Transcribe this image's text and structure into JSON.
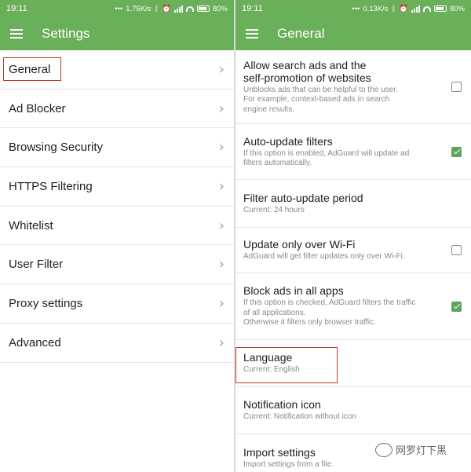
{
  "left": {
    "status": {
      "time": "19:11",
      "net_speed": "1.75K/s",
      "battery": "80%"
    },
    "toolbar_title": "Settings",
    "menu_items": [
      {
        "label": "General"
      },
      {
        "label": "Ad Blocker"
      },
      {
        "label": "Browsing Security"
      },
      {
        "label": "HTTPS Filtering"
      },
      {
        "label": "Whitelist"
      },
      {
        "label": "User Filter"
      },
      {
        "label": "Proxy settings"
      },
      {
        "label": "Advanced"
      }
    ],
    "chevron_glyph": "›"
  },
  "right": {
    "status": {
      "time": "19:11",
      "net_speed": "0.13K/s",
      "battery": "80%"
    },
    "toolbar_title": "General",
    "settings": [
      {
        "title_line1": "Allow search ads and the",
        "title_line2": "self-promotion of websites",
        "desc": [
          "Unblocks ads that can be helpful to the user.",
          "For example, context-based ads in search",
          "engine results."
        ],
        "checked": false
      },
      {
        "title": "Auto-update filters",
        "desc": [
          "If this option is enabled, AdGuard will update ad",
          "filters automatically."
        ],
        "checked": true
      },
      {
        "title": "Filter auto-update period",
        "desc": [
          "Current: 24 hours"
        ]
      },
      {
        "title": "Update only over Wi-Fi",
        "desc": [
          "AdGuard will get filter updates only over Wi-Fi."
        ],
        "checked": false
      },
      {
        "title": "Block ads in all apps",
        "desc": [
          "If this option is checked, AdGuard filters the traffic",
          "of all applications.",
          "Otherwise it filters only browser traffic."
        ],
        "checked": true
      },
      {
        "title": "Language",
        "desc": [
          "Current: English"
        ]
      },
      {
        "title": "Notification icon",
        "desc": [
          "Current: Notification without icon"
        ]
      },
      {
        "title": "Import settings",
        "desc": [
          "Import settings from a file."
        ]
      }
    ]
  },
  "watermark": {
    "text": "网罗灯下黑"
  },
  "colors": {
    "accent": "#6aaf59",
    "checkbox_checked": "#5aa55b",
    "highlight": "#c0392b"
  }
}
